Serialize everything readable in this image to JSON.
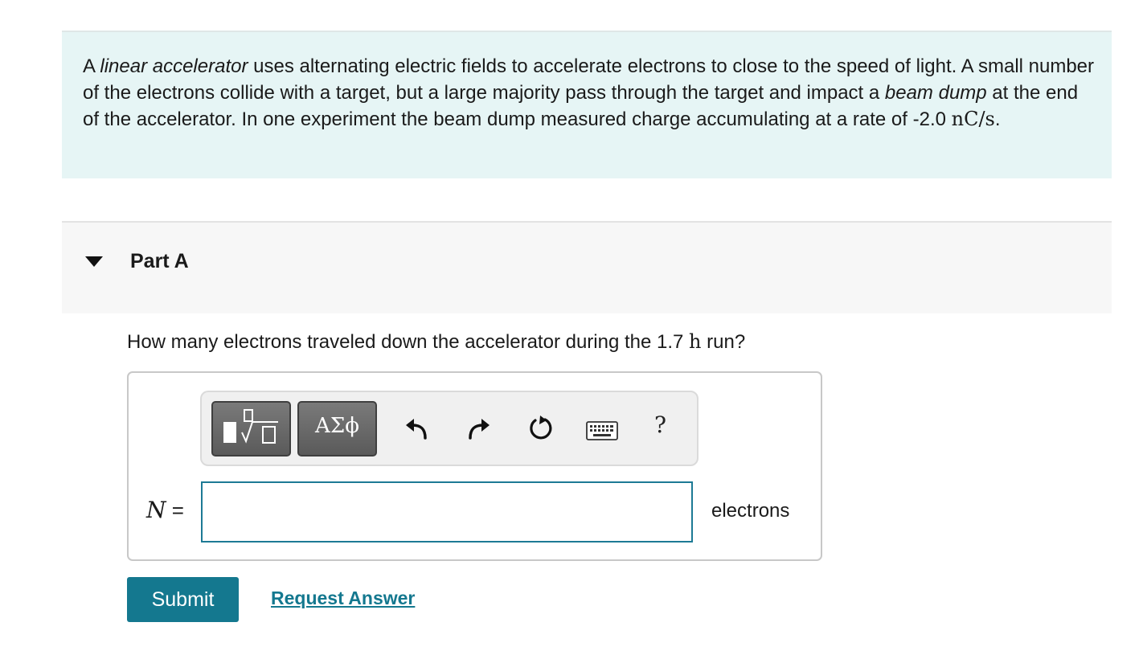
{
  "problem": {
    "intro_a": "A ",
    "term_linac": "linear accelerator",
    "intro_b": " uses alternating electric fields to accelerate electrons to close to the speed of light. A small number of the electrons collide with a target, but a large majority pass through the target and impact a ",
    "term_dump": "beam dump",
    "intro_c": " at the end of the accelerator. In one experiment the beam dump measured charge accumulating at a rate of -2.0 ",
    "rate_unit": "nC/s",
    "period": "."
  },
  "part": {
    "title": "Part A"
  },
  "question": {
    "text_a": "How many electrons traveled down the accelerator during the 1.7 ",
    "unit": "h",
    "text_b": " run?"
  },
  "toolbar": {
    "symbols_label": "ΑΣϕ",
    "help_label": "?",
    "icons": [
      "templates-icon",
      "greek-symbols-icon",
      "undo-icon",
      "redo-icon",
      "reset-icon",
      "keyboard-icon",
      "help-icon"
    ]
  },
  "answer": {
    "variable": "N",
    "equals": "=",
    "value": "",
    "unit": "electrons"
  },
  "actions": {
    "submit_label": "Submit",
    "request_label": "Request Answer"
  },
  "colors": {
    "problem_bg": "#e6f5f5",
    "accent": "#14788f",
    "input_border": "#1d7a95"
  }
}
